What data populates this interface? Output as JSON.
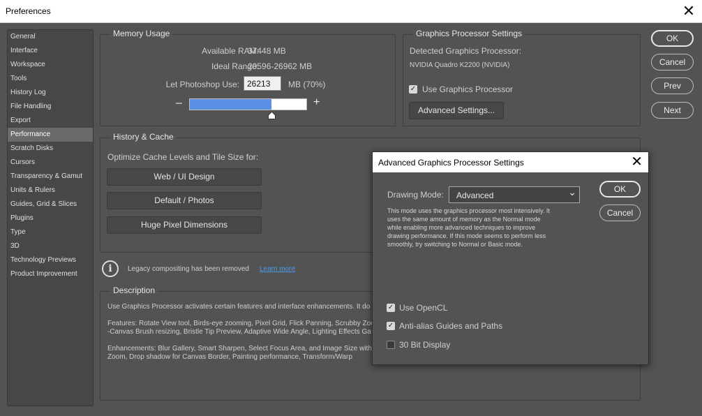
{
  "window": {
    "title": "Preferences",
    "close_glyph": "✕"
  },
  "sidebar": {
    "items": [
      {
        "label": "General"
      },
      {
        "label": "Interface"
      },
      {
        "label": "Workspace"
      },
      {
        "label": "Tools"
      },
      {
        "label": "History Log"
      },
      {
        "label": "File Handling"
      },
      {
        "label": "Export"
      },
      {
        "label": "Performance"
      },
      {
        "label": "Scratch Disks"
      },
      {
        "label": "Cursors"
      },
      {
        "label": "Transparency & Gamut"
      },
      {
        "label": "Units & Rulers"
      },
      {
        "label": "Guides, Grid & Slices"
      },
      {
        "label": "Plugins"
      },
      {
        "label": "Type"
      },
      {
        "label": "3D"
      },
      {
        "label": "Technology Previews"
      },
      {
        "label": "Product Improvement"
      }
    ],
    "selected": "Performance"
  },
  "memory": {
    "legend": "Memory Usage",
    "available_label": "Available RAM:",
    "available_value": "37448 MB",
    "ideal_label": "Ideal Range:",
    "ideal_value": "20596-26962 MB",
    "let_label": "Let Photoshop Use:",
    "let_value": "26213",
    "let_suffix": "MB (70%)",
    "minus": "–",
    "plus": "+",
    "usage_fraction": 0.7
  },
  "gpu": {
    "legend": "Graphics Processor Settings",
    "detected_label": "Detected Graphics Processor:",
    "detected_value": "NVIDIA Quadro K2200 (NVIDIA)",
    "use_gpu_label": "Use Graphics Processor",
    "use_gpu_checked": true,
    "advanced_button": "Advanced Settings..."
  },
  "history": {
    "legend": "History & Cache",
    "optimize_label": "Optimize Cache Levels and Tile Size for:",
    "buttons": [
      "Web / UI Design",
      "Default / Photos",
      "Huge Pixel Dimensions"
    ]
  },
  "legacy": {
    "info_glyph": "i",
    "text": "Legacy compositing has been removed",
    "link": "Learn more"
  },
  "description": {
    "legend": "Description",
    "line1": "Use Graphics Processor activates certain features and interface enhancements. It do",
    "line2": "Features: Rotate View tool, Birds-eye zooming, Pixel Grid, Flick Panning, Scrubby Zoo",
    "line3": "-Canvas Brush resizing, Bristle Tip Preview, Adaptive Wide Angle, Lighting Effects Ga",
    "line4": "Enhancements: Blur Gallery, Smart Sharpen, Select Focus Area, and Image Size with",
    "line5": "Zoom, Drop shadow for Canvas Border, Painting performance, Transform/Warp"
  },
  "side_buttons": {
    "ok": "OK",
    "cancel": "Cancel",
    "prev": "Prev",
    "next": "Next"
  },
  "dialog": {
    "title": "Advanced Graphics Processor Settings",
    "close_glyph": "✕",
    "drawing_mode_label": "Drawing Mode:",
    "drawing_mode_value": "Advanced",
    "chevron": "⌄",
    "mode_desc_1": "This mode uses the graphics processor most intensively.  It",
    "mode_desc_2": "uses the same amount of memory as the Normal mode",
    "mode_desc_3": "while enabling more advanced techniques to improve",
    "mode_desc_4": "drawing performance.  If this mode seems to perform less",
    "mode_desc_5": "smoothly, try switching to Normal or Basic mode.",
    "ok": "OK",
    "cancel": "Cancel",
    "checks": [
      {
        "label": "Use OpenCL",
        "checked": true
      },
      {
        "label": "Anti-alias Guides and Paths",
        "checked": true
      },
      {
        "label": "30 Bit Display",
        "checked": false
      }
    ],
    "check_mark": "✓"
  },
  "colors": {
    "slider_fill": "#5b8fe3",
    "link": "#4b9df0"
  }
}
